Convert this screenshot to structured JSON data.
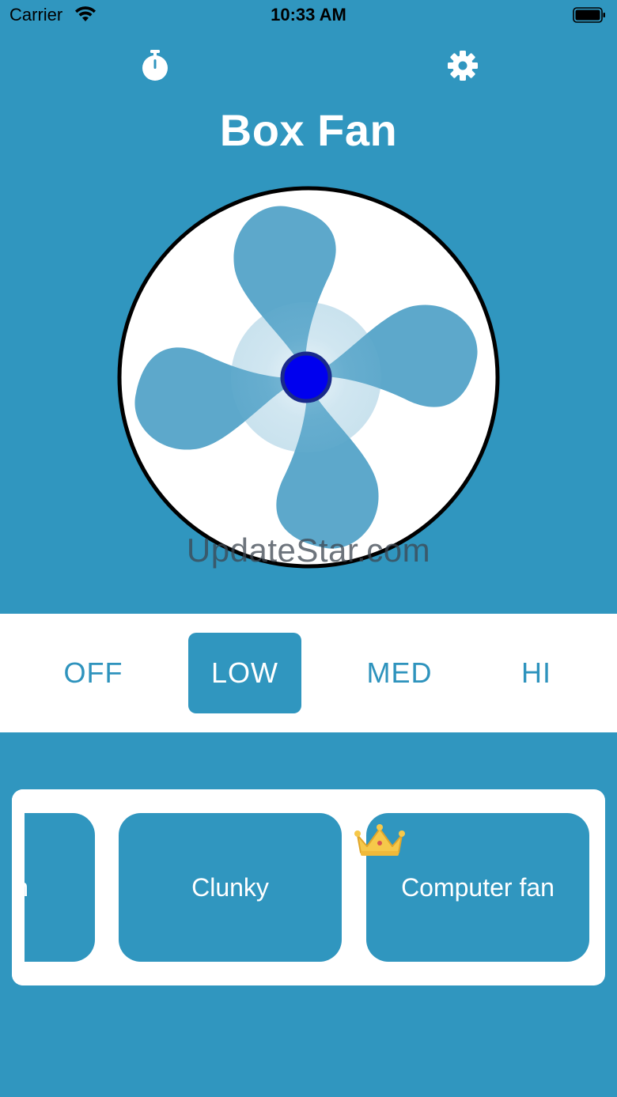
{
  "status_bar": {
    "carrier": "Carrier",
    "time": "10:33 AM"
  },
  "header": {
    "title": "Box Fan",
    "timer_icon": "stopwatch-icon",
    "settings_icon": "gear-icon"
  },
  "watermark": "UpdateStar.com",
  "speeds": {
    "options": [
      "OFF",
      "LOW",
      "MED",
      "HI"
    ],
    "selected": "LOW"
  },
  "sounds": {
    "partial_label": "n",
    "items": [
      "Clunky",
      "Computer fan"
    ],
    "premium_badge_icon": "crown-icon"
  },
  "colors": {
    "background": "#3096bf",
    "accent": "#2e93bd",
    "fan_blade": "#5da8cb",
    "fan_hub": "#0000ee"
  }
}
